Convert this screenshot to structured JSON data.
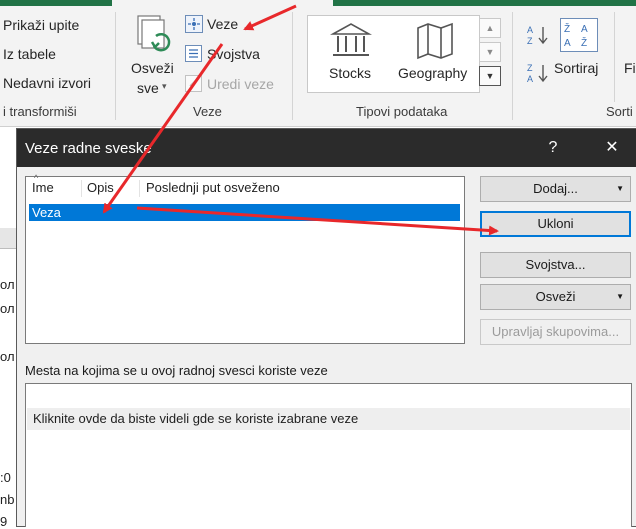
{
  "ribbon": {
    "get_data": {
      "items": [
        "Prikaži upite",
        "Iz tabele",
        "Nedavni izvori"
      ],
      "group_label": "i transformiši"
    },
    "refresh_all": {
      "line1": "Osveži",
      "line2": "sve"
    },
    "connections": {
      "items": [
        "Veze",
        "Svojstva",
        "Uredi veze"
      ],
      "group_label": "Veze"
    },
    "data_types": {
      "items": [
        "Stocks",
        "Geography"
      ],
      "group_label": "Tipovi podataka"
    },
    "sort": {
      "label": "Sortiraj",
      "filter_partial": "Fi",
      "group_label": "Sorti"
    }
  },
  "sheet_fragments": [
    "ол",
    "ол",
    "ол",
    ":0",
    "nb",
    "9"
  ],
  "dialog": {
    "title": "Veze radne sveske",
    "help": "?",
    "close": "✕",
    "columns": [
      "Ime",
      "Opis",
      "Poslednji put osveženo"
    ],
    "rows": [
      {
        "name": "Veza",
        "description": "",
        "last_refreshed": ""
      }
    ],
    "buttons": {
      "add": "Dodaj...",
      "remove": "Ukloni",
      "properties": "Svojstva...",
      "refresh": "Osveži",
      "manage_sets": "Upravljaj skupovima..."
    },
    "locations_label": "Mesta na kojima se u ovoj radnoj svesci koriste veze",
    "locations_hint": "Kliknite ovde da biste videli gde se koriste izabrane veze"
  },
  "colors": {
    "accent": "#0078d7",
    "excel_green": "#217346",
    "annotation_arrow": "#e8282b"
  }
}
